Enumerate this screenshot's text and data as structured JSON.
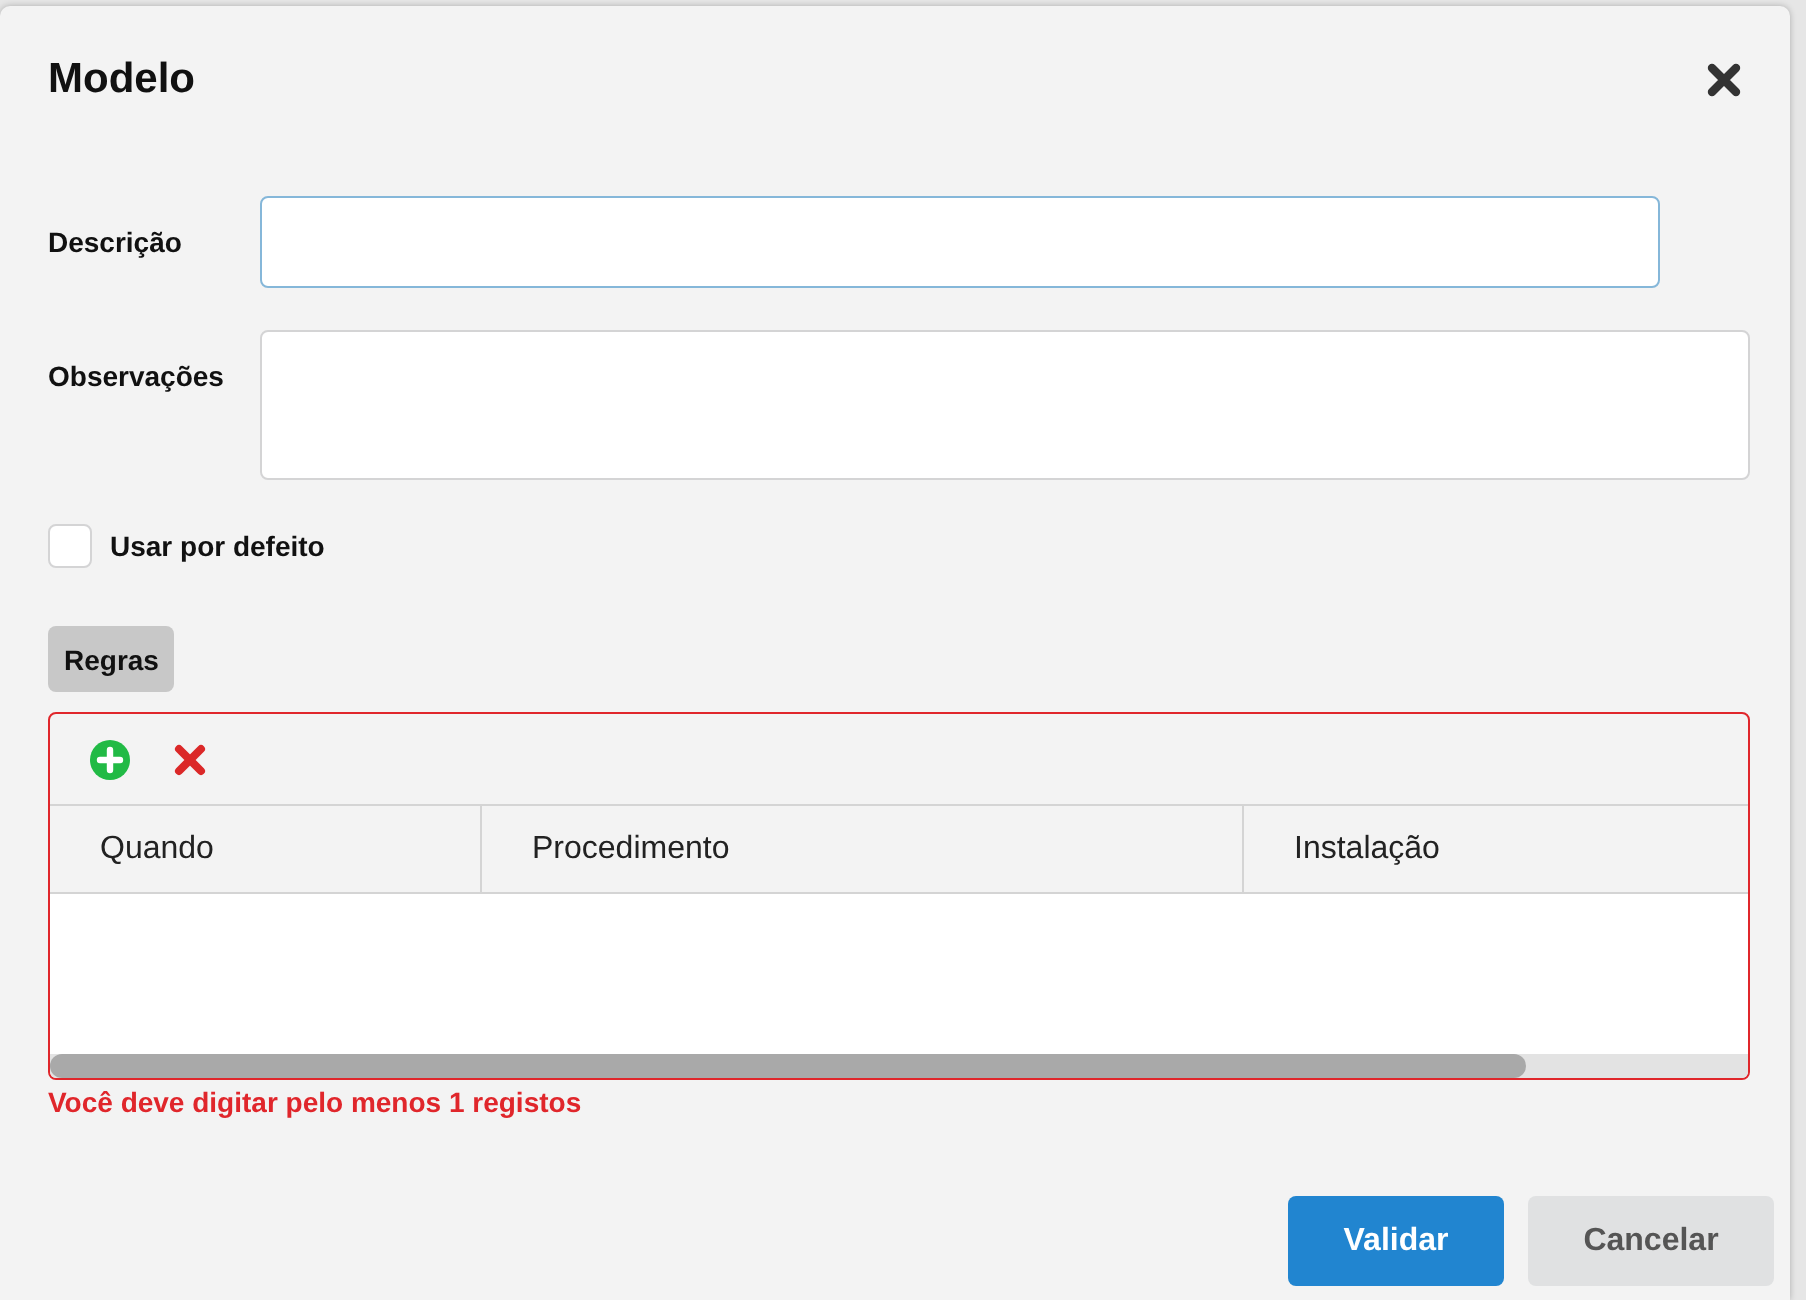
{
  "dialog": {
    "title": "Modelo"
  },
  "fields": [
    {
      "label": "Descrição",
      "kind": "input",
      "focused": true
    },
    {
      "label": "Observações",
      "kind": "textarea",
      "focused": false
    }
  ],
  "checkbox": {
    "label": "Usar por defeito",
    "checked": false
  },
  "tabs": [
    {
      "label": "Regras",
      "selected": true
    }
  ],
  "grid": {
    "invalid": true,
    "columns": [
      "Quando",
      "Procedimento",
      "Instalação"
    ],
    "error": "Você deve digitar pelo menos 1 registos"
  },
  "buttons": [
    {
      "label": "Validar",
      "kind": "primary"
    },
    {
      "label": "Cancelar",
      "kind": "secondary"
    }
  ]
}
